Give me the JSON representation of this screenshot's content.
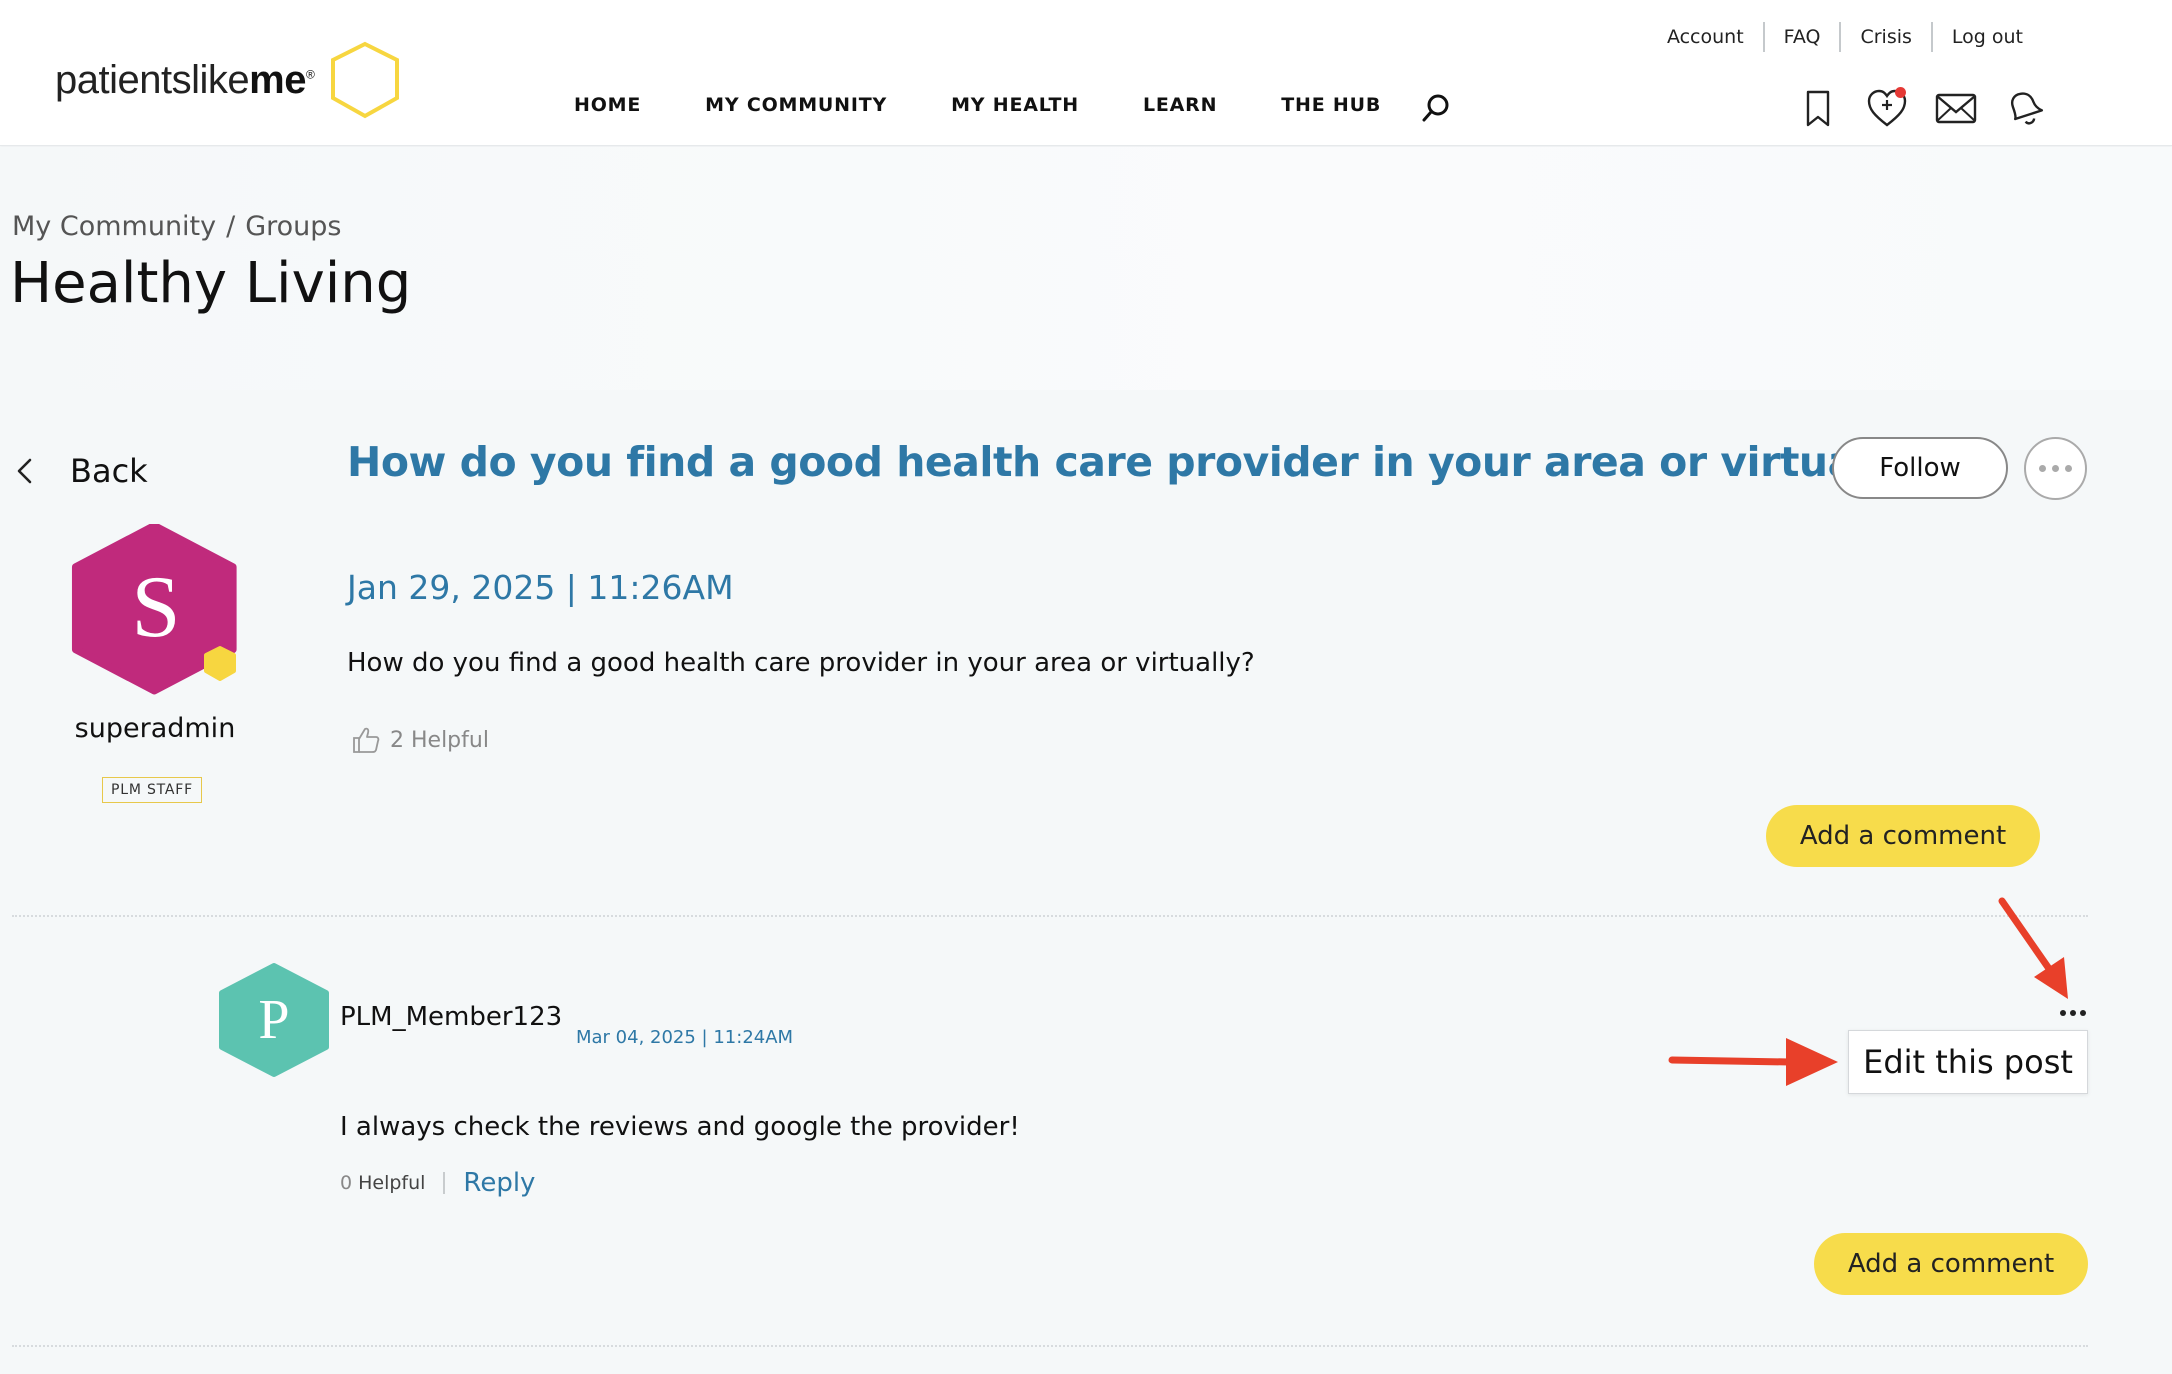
{
  "brand": {
    "logo_thin": "patientslike",
    "logo_bold": "me",
    "logo_reg": "®"
  },
  "top_links": [
    "Account",
    "FAQ",
    "Crisis",
    "Log out"
  ],
  "nav": [
    "HOME",
    "MY COMMUNITY",
    "MY HEALTH",
    "LEARN",
    "THE HUB"
  ],
  "header_icons": [
    "bookmark-icon",
    "heart-plus-icon",
    "mail-icon",
    "bell-icon"
  ],
  "breadcrumb": {
    "item1": "My Community",
    "sep": "/",
    "item2": "Groups"
  },
  "page_title": "Healthy Living",
  "back_label": "Back",
  "post": {
    "title": "How do you find a good health care provider in your area or virtually?",
    "follow_label": "Follow",
    "date": "Jan 29, 2025 | 11:26AM",
    "body": "How do you find a good health care provider in your area or virtually?",
    "helpful": "2 Helpful",
    "add_comment": "Add a comment",
    "author": {
      "initial": "S",
      "name": "superadmin",
      "badge": "PLM STAFF",
      "color": "#c02a7c",
      "badge_color": "#f7d640"
    }
  },
  "comment": {
    "author": {
      "initial": "P",
      "name": "PLM_Member123",
      "color": "#5cc3b0"
    },
    "date": "Mar 04, 2025 | 11:24AM",
    "edit_menu_label": "Edit this post",
    "body": "I always check the reviews and google the provider!",
    "helpful_count": "0",
    "helpful_label": "Helpful",
    "reply": "Reply",
    "add_comment": "Add a comment"
  },
  "colors": {
    "accent_blue": "#2e78a6",
    "cta_yellow": "#f7dc4b",
    "annotation_red": "#e8402a"
  }
}
